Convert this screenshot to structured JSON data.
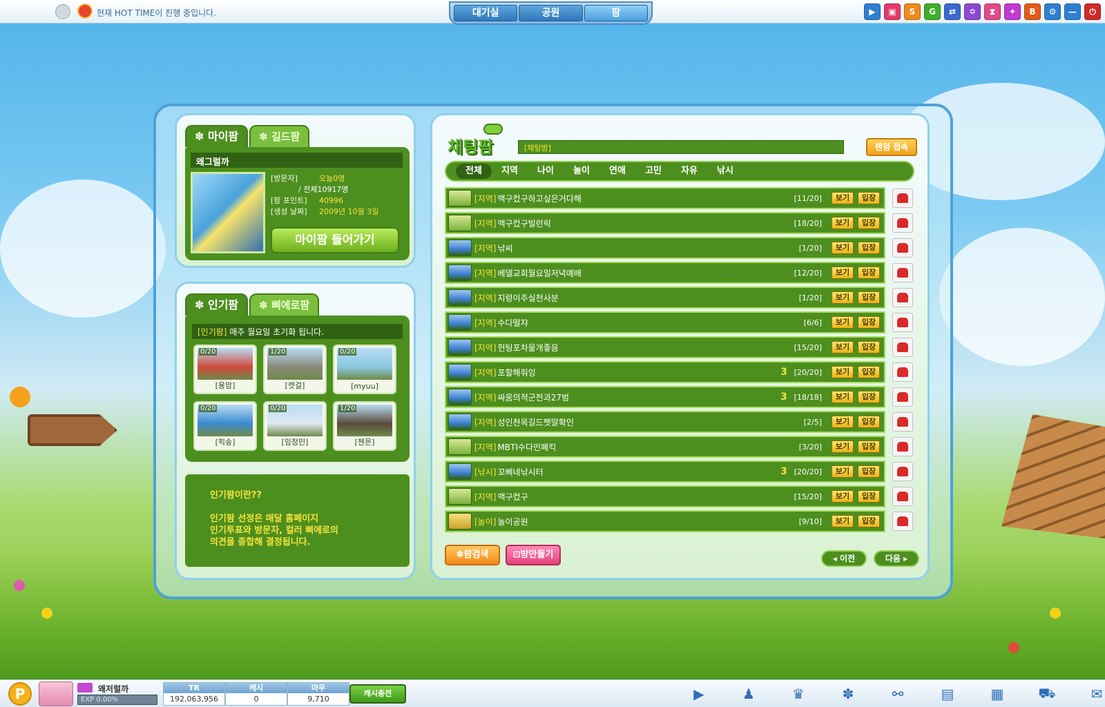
{
  "topbar": {
    "hot_time": "현재 HOT TIME이 진행 중입니다.",
    "nav_tabs": [
      "대기실",
      "공원",
      "팜"
    ],
    "active_tab": 2,
    "icons": [
      {
        "name": "play-icon",
        "glyph": "▶",
        "color": "#2f7fd0"
      },
      {
        "name": "bus-icon",
        "glyph": "▣",
        "color": "#e23a6a"
      },
      {
        "name": "story-icon",
        "glyph": "S",
        "color": "#f08a1a"
      },
      {
        "name": "g-icon",
        "glyph": "G",
        "color": "#3fae2a"
      },
      {
        "name": "arrows-icon",
        "glyph": "⇄",
        "color": "#3a6ad0"
      },
      {
        "name": "star-gear-icon",
        "glyph": "✡",
        "color": "#8a4ad0"
      },
      {
        "name": "hourglass-icon",
        "glyph": "⧗",
        "color": "#e24a8a"
      },
      {
        "name": "sparkle-icon",
        "glyph": "✦",
        "color": "#c03ad0"
      },
      {
        "name": "book-icon",
        "glyph": "B",
        "color": "#e25a1a"
      },
      {
        "name": "settings-icon",
        "glyph": "⚙",
        "color": "#2f7fd0"
      },
      {
        "name": "minimize-icon",
        "glyph": "—",
        "color": "#2f7fd0"
      },
      {
        "name": "power-icon",
        "glyph": "⏻",
        "color": "#d02a2a"
      }
    ]
  },
  "myfarm": {
    "tab_my": "마이팜",
    "tab_guild": "길드팜",
    "owner": "왜그럴까",
    "visitor_label": "[방문자]",
    "visitor_today": "오늘0명",
    "visitor_total": "/ 전체10917명",
    "points_label": "[팜 포인트]",
    "points_value": "40996",
    "created_label": "[생성 날짜]",
    "created_value": "2009년 10월 3일",
    "enter_button": "마이팜 들어가기"
  },
  "popfarm": {
    "tab_popular": "인기팜",
    "tab_pierrot": "삐에로팜",
    "notice_tag": "[인기팜]",
    "notice_text": "매주 월요일 초기화 됩니다.",
    "cards": [
      {
        "count": "0/20",
        "name": "[용암]",
        "color": "#d04a3a"
      },
      {
        "count": "1/20",
        "name": "[캣걸]",
        "color": "#8a8a7a"
      },
      {
        "count": "0/20",
        "name": "[myuu]",
        "color": "#8ac8e0"
      },
      {
        "count": "0/20",
        "name": "[픽송]",
        "color": "#3a8ad0"
      },
      {
        "count": "0/20",
        "name": "[임정민]",
        "color": "#e0e8f0"
      },
      {
        "count": "1/20",
        "name": "[젠몬]",
        "color": "#5a4a3a"
      }
    ],
    "info_title": "인기팜이란??",
    "info_line1": "인기팜 선정은 매달 홈페이지",
    "info_line2": "인기투표와 방문자, 컬러 삐에로의",
    "info_line3": "의견을 종합해 결정됩니다."
  },
  "chat": {
    "logo": "채팅팜",
    "room_input": "[채팅방]",
    "random_button": "랜덤 접속",
    "categories": [
      "전체",
      "지역",
      "나이",
      "놀이",
      "연애",
      "고민",
      "자유",
      "낚시"
    ],
    "view_label": "보기",
    "join_label": "입장",
    "rooms": [
      {
        "tag": "[지역]",
        "title": "맥구컸구하고싶은거다해",
        "count": "[11/20]",
        "icon": "g",
        "star": ""
      },
      {
        "tag": "[지역]",
        "title": "맥구컸구빌런릭",
        "count": "[18/20]",
        "icon": "g",
        "star": ""
      },
      {
        "tag": "[지역]",
        "title": "낚씨",
        "count": "[1/20]",
        "icon": "b",
        "star": ""
      },
      {
        "tag": "[지역]",
        "title": "베델교회월요일저녁예배",
        "count": "[12/20]",
        "icon": "b",
        "star": ""
      },
      {
        "tag": "[지역]",
        "title": "지렁이주실천사분",
        "count": "[1/20]",
        "icon": "b",
        "star": ""
      },
      {
        "tag": "[지역]",
        "title": "수다떨쟈",
        "count": "[6/6]",
        "icon": "b",
        "star": ""
      },
      {
        "tag": "[지역]",
        "title": "헌팅포차물개좋음",
        "count": "[15/20]",
        "icon": "b",
        "star": ""
      },
      {
        "tag": "[지역]",
        "title": "포할해줘잉",
        "count": "[20/20]",
        "icon": "b",
        "star": "3"
      },
      {
        "tag": "[지역]",
        "title": "싸움의적군전과27범",
        "count": "[18/18]",
        "icon": "b",
        "star": "3"
      },
      {
        "tag": "[지역]",
        "title": "성인천목길드펫말확인",
        "count": "[2/5]",
        "icon": "b",
        "star": ""
      },
      {
        "tag": "[지역]",
        "title": "MBTI수다민폐킥",
        "count": "[3/20]",
        "icon": "g",
        "star": ""
      },
      {
        "tag": "[낚시]",
        "title": "꼬삐네낚시터",
        "count": "[20/20]",
        "icon": "b",
        "star": "3"
      },
      {
        "tag": "[지역]",
        "title": "맥구컸구",
        "count": "[15/20]",
        "icon": "g",
        "star": ""
      },
      {
        "tag": "[놀이]",
        "title": "놀이공원",
        "count": "[9/10]",
        "icon": "y",
        "star": ""
      }
    ],
    "search_button": "팜검색",
    "create_button": "방만들기",
    "prev_button": "이전",
    "next_button": "다음"
  },
  "bottombar": {
    "p_label": "P",
    "user_name": "왜저럴까",
    "exp": "EXP 0.00%",
    "currencies": [
      {
        "label": "TR",
        "value": "192,063,956"
      },
      {
        "label": "캐시",
        "value": "0"
      },
      {
        "label": "마우",
        "value": "9,710"
      }
    ],
    "cash_button": "캐시충전",
    "icons": [
      {
        "name": "play-icon",
        "glyph": "▶"
      },
      {
        "name": "friends-icon",
        "glyph": "♟"
      },
      {
        "name": "trophy-icon",
        "glyph": "♛"
      },
      {
        "name": "pet-paw-icon",
        "glyph": "✽"
      },
      {
        "name": "handshake-icon",
        "glyph": "⚯"
      },
      {
        "name": "gift-box-icon",
        "glyph": "▤"
      },
      {
        "name": "bag-icon",
        "glyph": "▦"
      },
      {
        "name": "cart-icon",
        "glyph": "⛟"
      },
      {
        "name": "chat-icon",
        "glyph": "✉"
      }
    ]
  }
}
